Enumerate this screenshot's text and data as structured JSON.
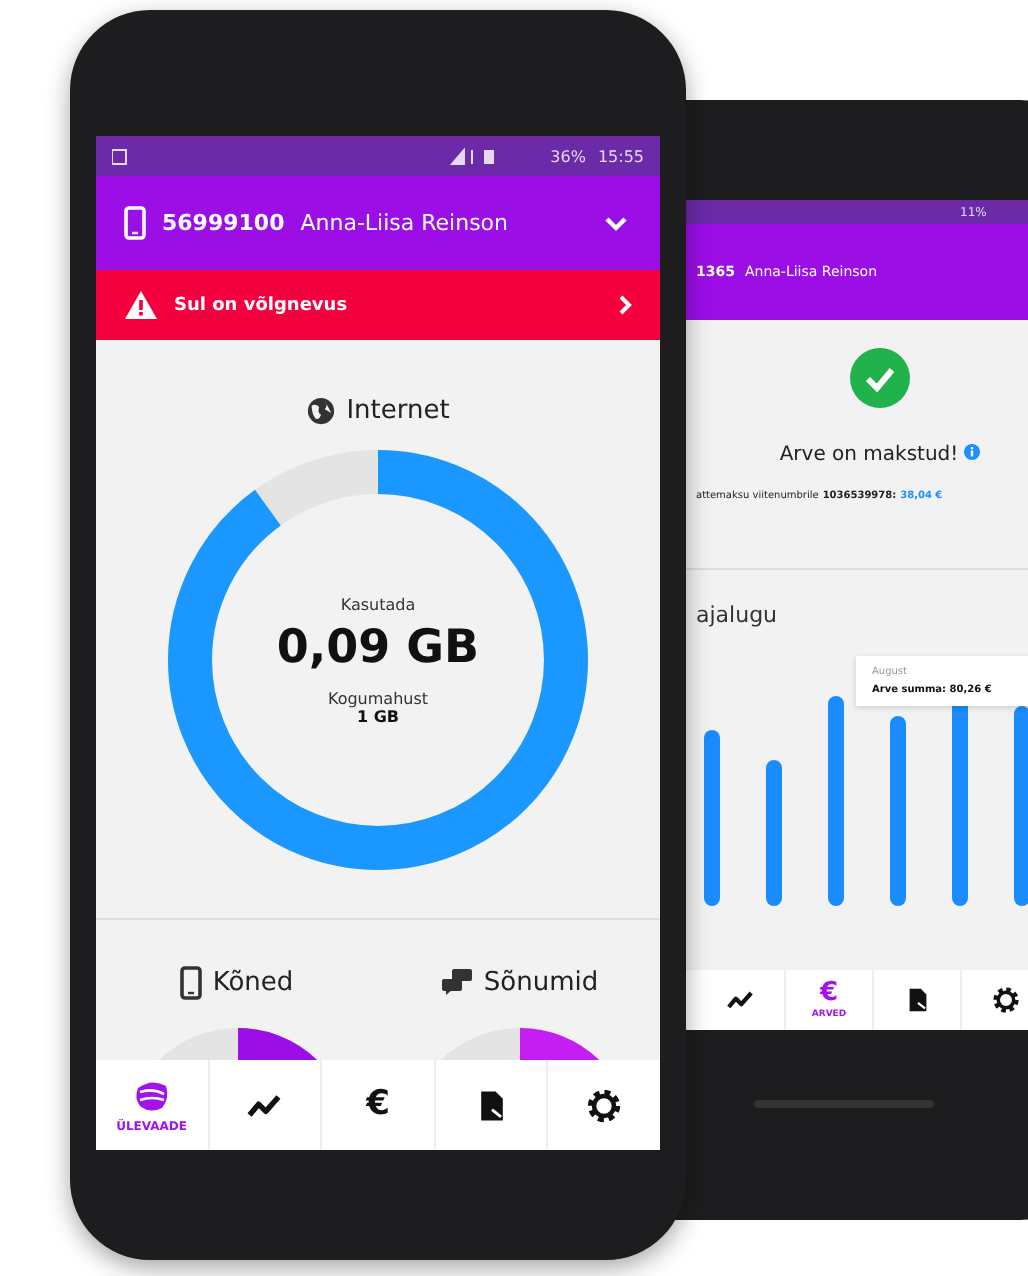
{
  "front_phone": {
    "status_bar": {
      "battery": "36%",
      "time": "15:55"
    },
    "header": {
      "number": "56999100",
      "name": "Anna-Liisa Reinson"
    },
    "alert": {
      "text": "Sul on võlgnevus"
    },
    "internet": {
      "title": "Internet",
      "caption": "Kasutada",
      "amount": "0,09 GB",
      "total_label": "Kogumahust",
      "total": "1 GB"
    },
    "sections": [
      {
        "kind": "calls",
        "title": "Kõned"
      },
      {
        "kind": "messages",
        "title": "Sõnumid"
      }
    ],
    "nav": [
      {
        "kind": "overview",
        "label": "ÜLEVAADE",
        "selected": true
      },
      {
        "kind": "trend",
        "selected": false
      },
      {
        "kind": "euro",
        "glyph": "€",
        "selected": false
      },
      {
        "kind": "document",
        "selected": false
      },
      {
        "kind": "settings",
        "selected": false
      }
    ]
  },
  "back_phone": {
    "status_bar": {
      "battery": "11%"
    },
    "header": {
      "number": "1365",
      "name": "Anna-Liisa Reinson"
    },
    "status_title": "Arve on makstud!",
    "payment_line": {
      "text": "attemaksu viitenumbrile",
      "reference": "1036539978:",
      "amount": "38,04 €"
    },
    "history_title": "ajalugu",
    "tooltip": {
      "month": "August",
      "text": "Arve summa: 80,26 €"
    },
    "nav": [
      {
        "kind": "trend",
        "selected": false
      },
      {
        "kind": "euro",
        "glyph": "€",
        "label": "ARVED",
        "selected": true
      },
      {
        "kind": "document",
        "selected": false
      },
      {
        "kind": "settings",
        "selected": false
      }
    ]
  }
}
